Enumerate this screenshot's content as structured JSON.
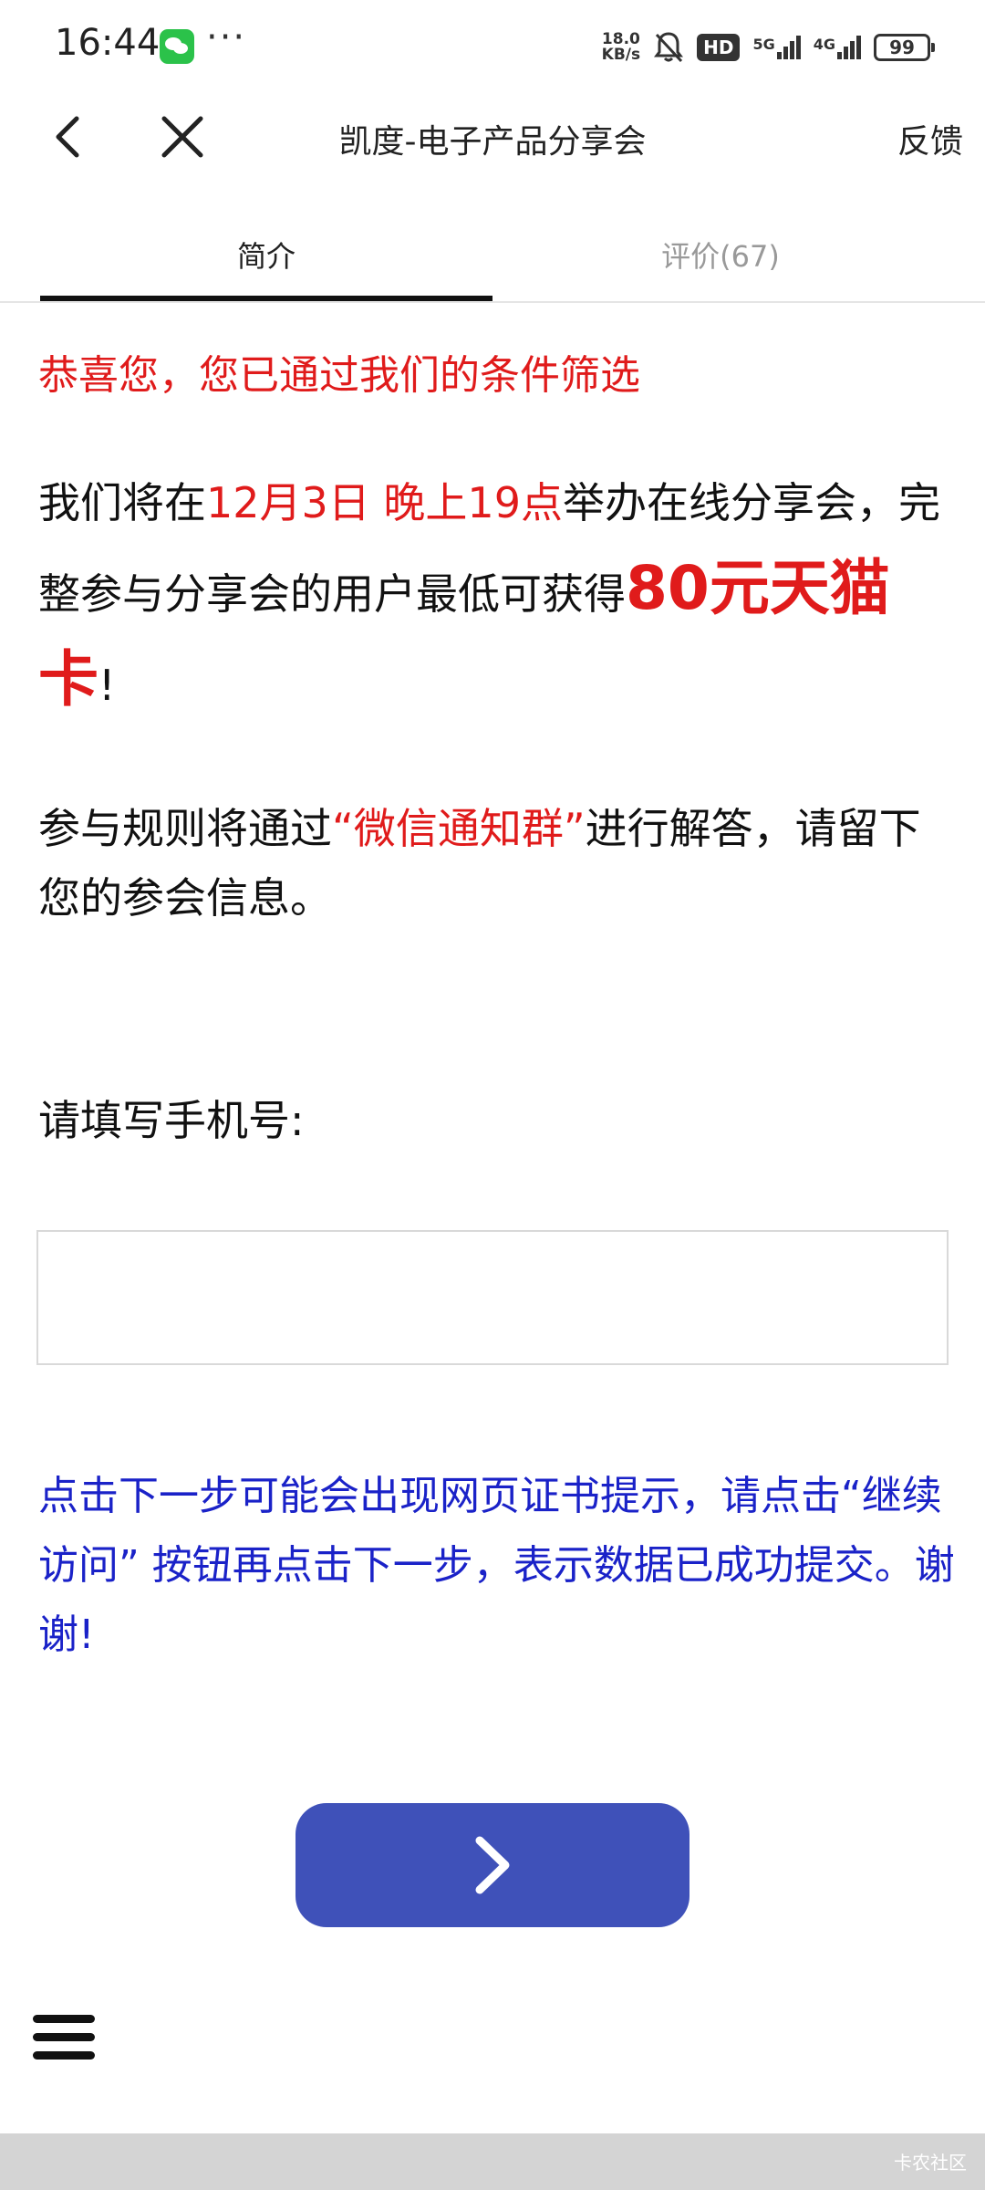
{
  "status_bar": {
    "time": "16:44",
    "dots": "···",
    "speed_value": "18.0",
    "speed_unit": "KB/s",
    "hd_label": "HD",
    "net1_label": "5G",
    "net2_label": "4G",
    "battery": "99",
    "icons": [
      "wechat-icon",
      "bell-muted-icon",
      "signal-icon",
      "battery-icon"
    ]
  },
  "nav": {
    "title": "凯度-电子产品分享会",
    "feedback": "反馈",
    "icons": [
      "back-arrow-icon",
      "close-icon"
    ]
  },
  "tabs": [
    {
      "label": "简介",
      "active": true
    },
    {
      "label": "评价(67)",
      "active": false
    }
  ],
  "content": {
    "congrats": "恭喜您，您已通过我们的条件筛选",
    "para1": {
      "part1": "我们将在",
      "date": "12月3日 晚上19点",
      "part2": "举办在线分享会，完整参与分享会的用户最低可获得",
      "reward": "80元天猫卡",
      "part3": "!"
    },
    "para2": {
      "part1": "参与规则将通过",
      "group": "“微信通知群”",
      "part2": "进行解答，请留下您的参会信息。"
    },
    "phone_label": "请填写手机号:",
    "phone_value": "",
    "notice": "点击下一步可能会出现网页证书提示，请点击“继续访问” 按钮再点击下一步，表示数据已成功提交。谢谢!"
  },
  "buttons": {
    "next_icon": "chevron-right-icon",
    "menu_icon": "hamburger-menu-icon"
  },
  "colors": {
    "accent_red": "#e01b1b",
    "notice_blue": "#1a22c8",
    "button_blue": "#3f51b9"
  },
  "watermark": "卡农社区"
}
